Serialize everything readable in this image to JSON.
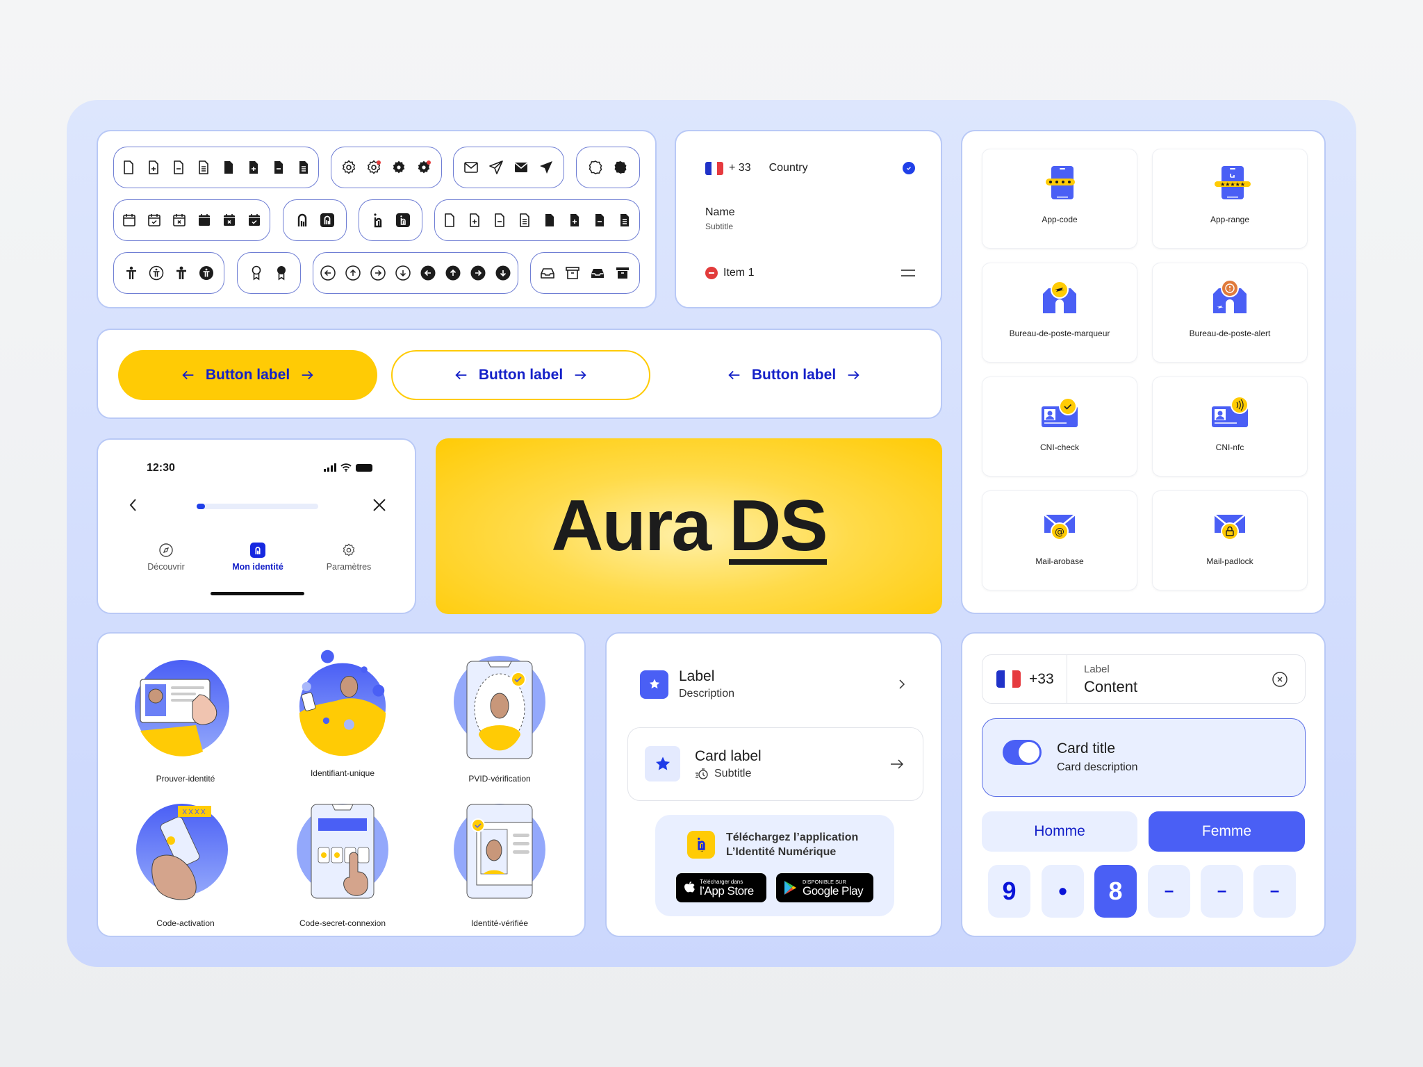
{
  "colors": {
    "accent_blue": "#4a5ff5",
    "deep_blue": "#1420c8",
    "yellow": "#ffcb05",
    "light_blue_bg": "#e9efff",
    "frame_bg": "#d4defd",
    "red": "#e23b3b"
  },
  "icon_library": {
    "rows": [
      [
        {
          "group": "document",
          "icons": [
            "document-icon",
            "document-add-icon",
            "document-remove-icon",
            "document-text-icon",
            "document-filled-icon",
            "document-add-filled-icon",
            "document-remove-filled-icon",
            "document-text-filled-icon"
          ]
        },
        {
          "group": "settings",
          "icons": [
            "gear-icon",
            "gear-notification-icon",
            "gear-filled-icon",
            "gear-filled-notification-icon"
          ]
        },
        {
          "group": "mail-send",
          "icons": [
            "mail-icon",
            "send-icon",
            "mail-filled-icon",
            "send-filled-icon"
          ]
        },
        {
          "group": "badge",
          "icons": [
            "badge-icon",
            "badge-filled-icon"
          ]
        }
      ],
      [
        {
          "group": "calendar",
          "icons": [
            "calendar-icon",
            "calendar-check-icon",
            "calendar-x-icon",
            "calendar-filled-icon",
            "calendar-x-filled-icon",
            "calendar-check-filled-icon"
          ]
        },
        {
          "group": "identity-logo-lock",
          "icons": [
            "identity-lock-icon",
            "identity-lock-filled-icon"
          ]
        },
        {
          "group": "identity-logo",
          "icons": [
            "identity-logo-icon",
            "identity-logo-filled-icon"
          ]
        },
        {
          "group": "document-2",
          "icons": [
            "document-icon",
            "document-add-icon",
            "document-remove-icon",
            "document-text-icon",
            "document-filled-icon",
            "document-add-filled-icon",
            "document-remove-filled-icon",
            "document-text-filled-icon"
          ]
        }
      ],
      [
        {
          "group": "accessibility",
          "icons": [
            "accessibility-icon",
            "accessibility-circle-icon",
            "accessibility-bold-icon",
            "accessibility-circle-filled-icon"
          ]
        },
        {
          "group": "award",
          "icons": [
            "award-icon",
            "award-filled-icon"
          ]
        },
        {
          "group": "arrows-circle",
          "icons": [
            "arrow-left-circle-icon",
            "arrow-up-circle-icon",
            "arrow-right-circle-icon",
            "arrow-down-circle-icon",
            "arrow-left-circle-filled-icon",
            "arrow-up-circle-filled-icon",
            "arrow-right-circle-filled-icon",
            "arrow-down-circle-filled-icon"
          ]
        },
        {
          "group": "archive",
          "icons": [
            "inbox-icon",
            "archive-icon",
            "inbox-filled-icon",
            "archive-filled-icon"
          ]
        }
      ]
    ]
  },
  "country_card": {
    "dial_code": "+ 33",
    "country_label": "Country",
    "name": "Name",
    "subtitle": "Subtitle",
    "item": "Item 1"
  },
  "buttons": {
    "primary": "Button label",
    "secondary": "Button label",
    "tertiary": "Button label"
  },
  "phone": {
    "time": "12:30",
    "progress": 0.05,
    "nav": [
      {
        "label": "Découvrir",
        "icon": "compass-icon",
        "active": false
      },
      {
        "label": "Mon identité",
        "icon": "identity-logo-icon",
        "active": true
      },
      {
        "label": "Paramètres",
        "icon": "gear-icon",
        "active": false
      }
    ]
  },
  "hero": {
    "title_part1": "Aura",
    "title_part2": "DS"
  },
  "illustrations": [
    {
      "label": "Prouver-identité"
    },
    {
      "label": "Identifiant-unique"
    },
    {
      "label": "PVID-vérification"
    },
    {
      "label": "Code-activation"
    },
    {
      "label": "Code-secret-connexion"
    },
    {
      "label": "Identité-vérifiée"
    }
  ],
  "list": {
    "item_label": "Label",
    "item_description": "Description",
    "card_label": "Card label",
    "card_subtitle": "Subtitle"
  },
  "download": {
    "line1": "Téléchargez l’application",
    "line2": "L’Identité Numérique",
    "appstore_small": "Télécharger dans",
    "appstore_big": "l’App Store",
    "play_small": "DISPONIBLE SUR",
    "play_big": "Google Play"
  },
  "app_icons": [
    {
      "label": "App-code"
    },
    {
      "label": "App-range"
    },
    {
      "label": "Bureau-de-poste-marqueur"
    },
    {
      "label": "Bureau-de-poste-alert"
    },
    {
      "label": "CNI-check"
    },
    {
      "label": "CNI-nfc"
    },
    {
      "label": "Mail-arobase"
    },
    {
      "label": "Mail-padlock"
    }
  ],
  "form": {
    "dial_code": "+33",
    "field_label": "Label",
    "field_value": "Content",
    "toggle_on": true,
    "card_title": "Card title",
    "card_description": "Card description",
    "gender_options": [
      "Homme",
      "Femme"
    ],
    "gender_selected": "Femme",
    "otp": [
      "9",
      "•",
      "8",
      "–",
      "–",
      "–"
    ]
  }
}
